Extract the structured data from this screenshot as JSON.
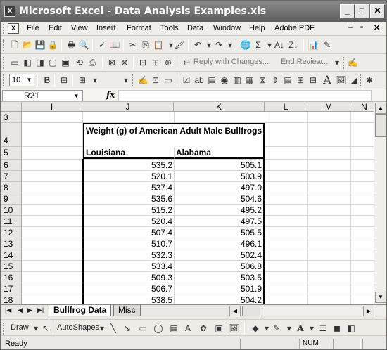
{
  "window": {
    "app_icon": "excel-icon",
    "title": "Microsoft Excel - Data Analysis Examples.xls",
    "minimize": "_",
    "maximize": "□",
    "close": "✕"
  },
  "menubar": {
    "items": [
      "File",
      "Edit",
      "View",
      "Insert",
      "Format",
      "Tools",
      "Data",
      "Window",
      "Help",
      "Adobe PDF"
    ],
    "doc_controls": [
      "-",
      "&#x2716;"
    ]
  },
  "toolbar2": {
    "reply_label": "Reply with Changes...",
    "end_review_label": "End Review..."
  },
  "toolbar3": {
    "font_size": "10",
    "bold": "B"
  },
  "formula_bar": {
    "name_box": "R21",
    "fx": "fx",
    "value": ""
  },
  "grid": {
    "columns": [
      "I",
      "J",
      "K",
      "L",
      "M",
      "N"
    ],
    "rows": [
      "3",
      "4",
      "5",
      "6",
      "7",
      "8",
      "9",
      "10",
      "11",
      "12",
      "13",
      "14",
      "15",
      "16",
      "17",
      "18"
    ],
    "table_title": "Weight (g) of American Adult Male Bullfrogs",
    "col_headers": [
      "Louisiana",
      "Alabama"
    ],
    "louisiana": [
      "535.2",
      "520.1",
      "537.4",
      "535.6",
      "515.2",
      "520.4",
      "507.4",
      "510.7",
      "532.3",
      "533.4",
      "509.3",
      "506.7",
      "538.5"
    ],
    "alabama": [
      "505.1",
      "503.9",
      "497.0",
      "504.6",
      "495.2",
      "497.5",
      "505.5",
      "496.1",
      "502.4",
      "506.8",
      "503.5",
      "501.9",
      "504.2"
    ]
  },
  "sheets": {
    "tabs": [
      "Bullfrog Data",
      "Misc"
    ],
    "active": "Bullfrog Data"
  },
  "drawbar": {
    "draw": "Draw",
    "autoshapes": "AutoShapes"
  },
  "statusbar": {
    "status": "Ready",
    "num": "NUM"
  }
}
